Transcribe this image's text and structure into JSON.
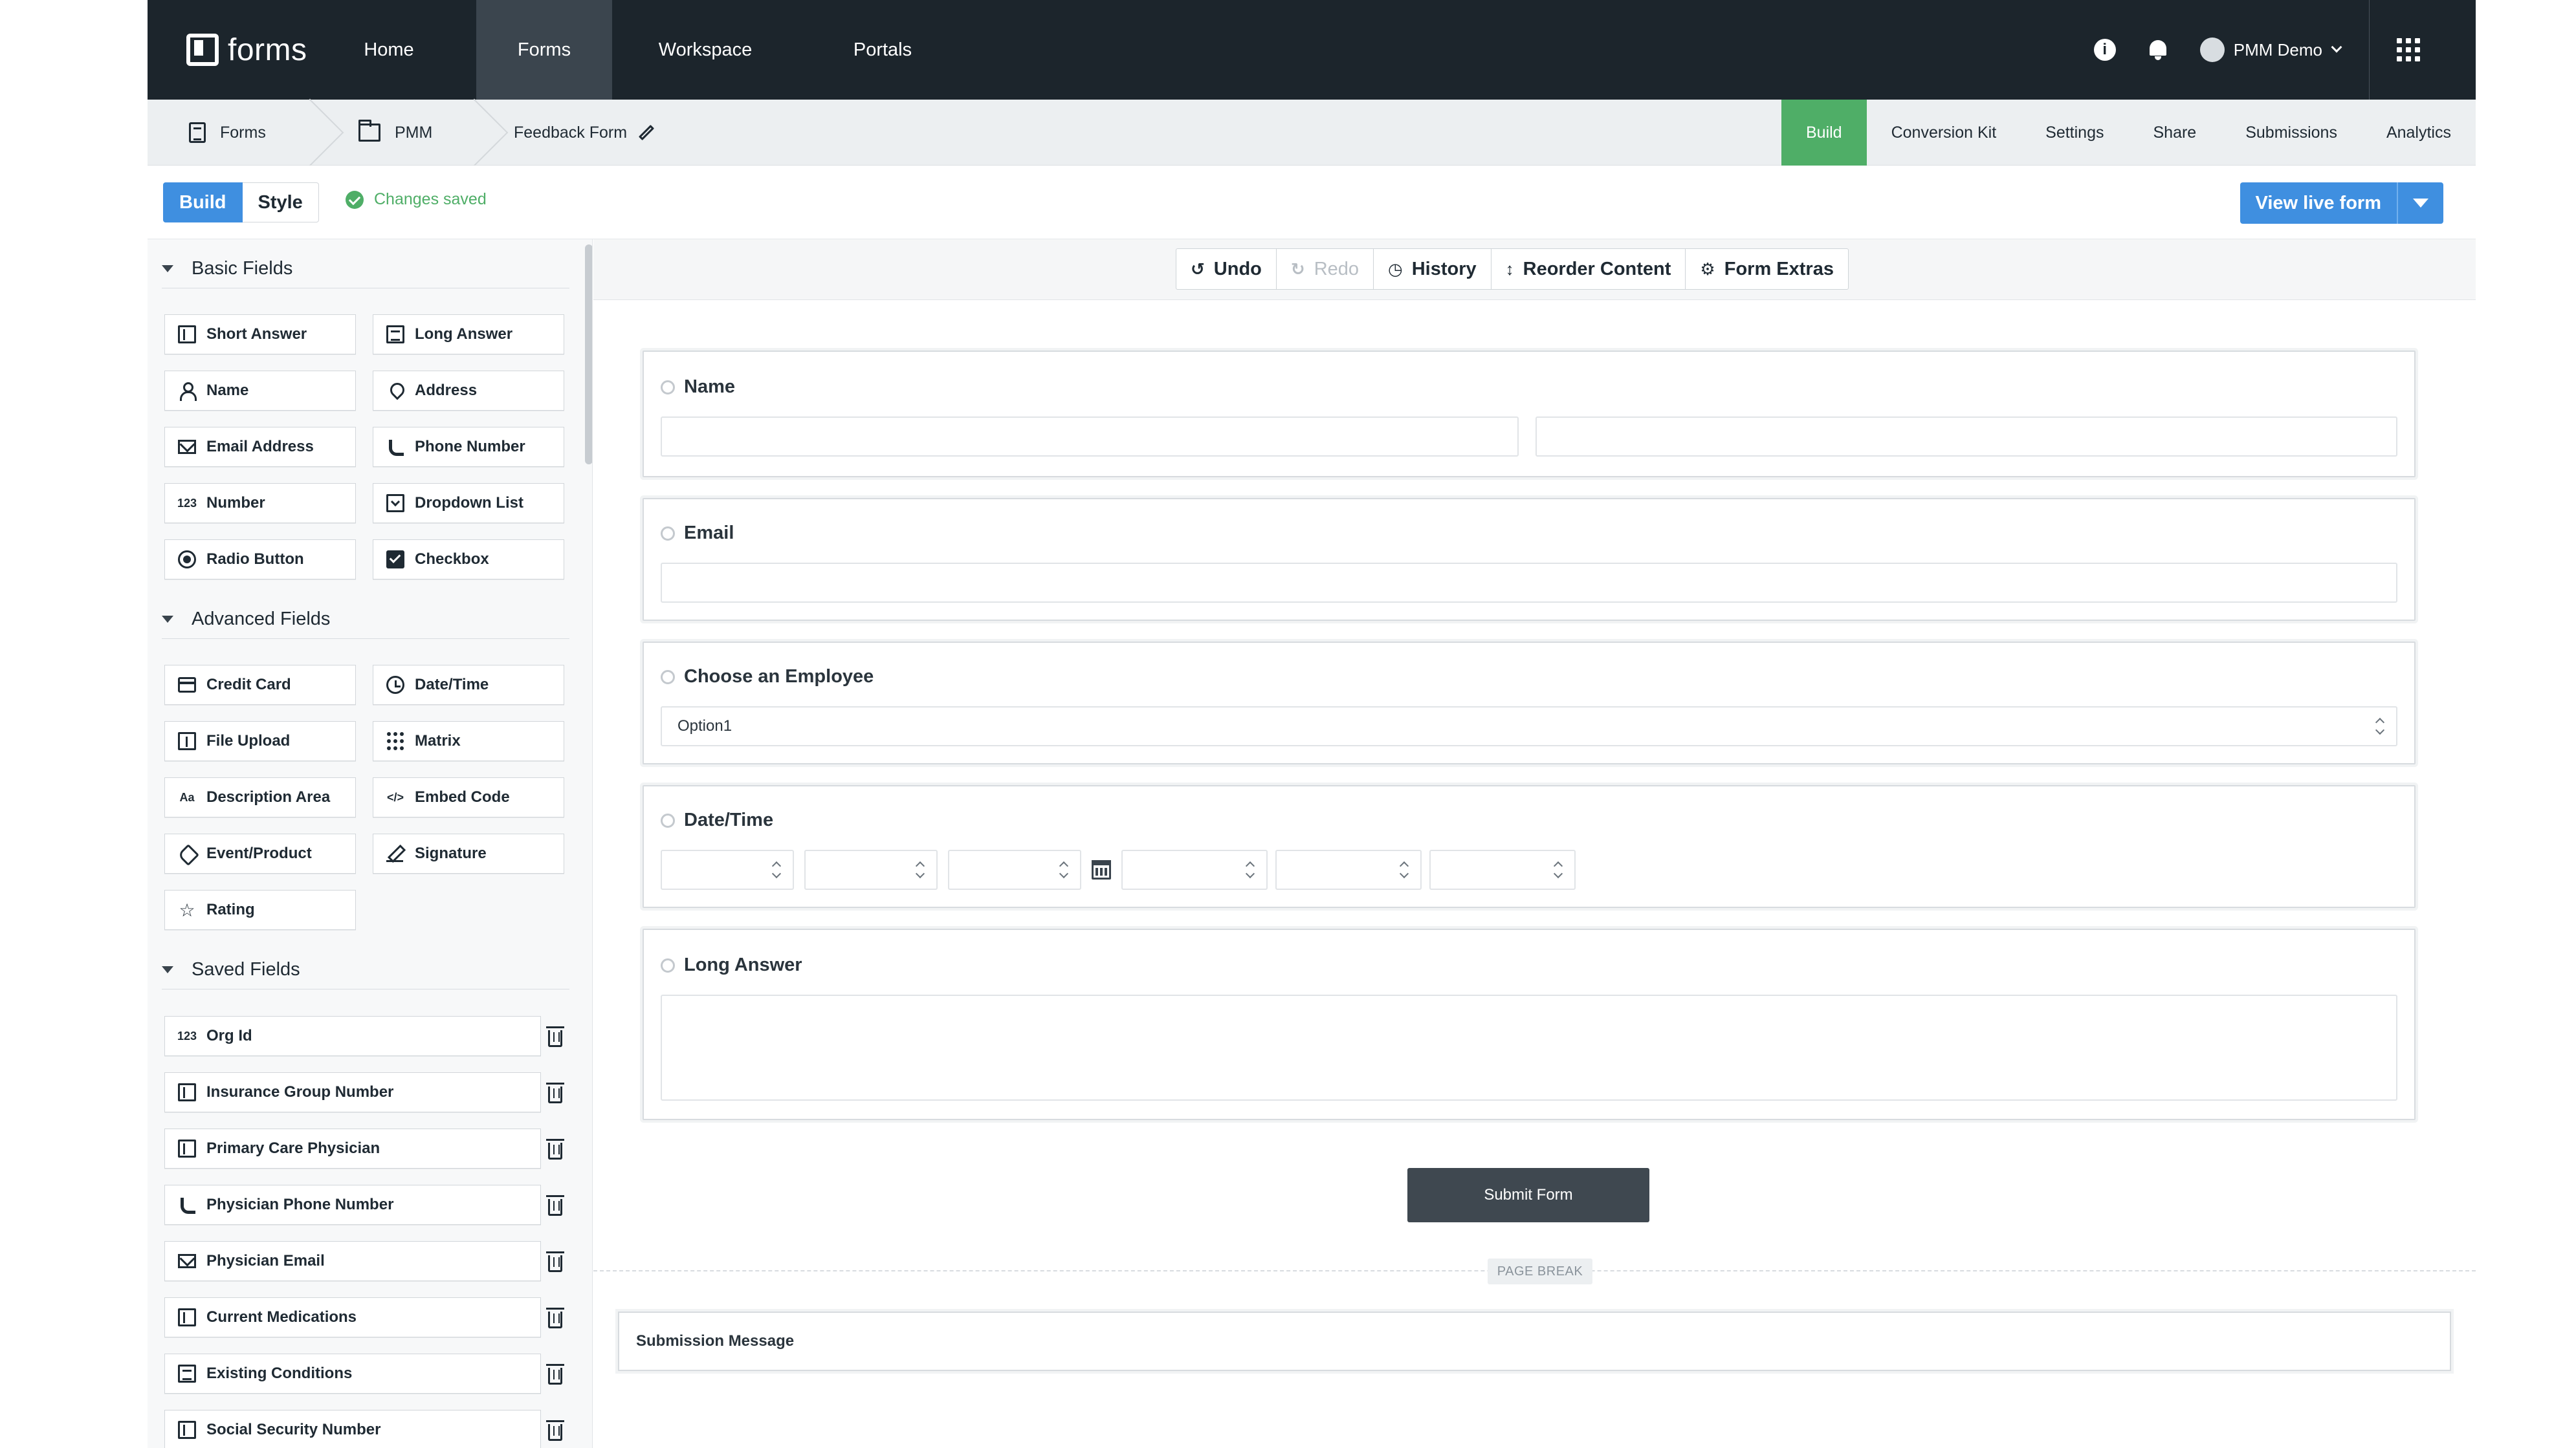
{
  "topnav": {
    "logo_text": "forms",
    "items": [
      {
        "label": "Home"
      },
      {
        "label": "Forms",
        "active": true
      },
      {
        "label": "Workspace"
      },
      {
        "label": "Portals"
      }
    ],
    "info_glyph": "i",
    "user_name": "PMM Demo"
  },
  "breadcrumb": {
    "items": [
      {
        "label": "Forms",
        "icon": "form-icon"
      },
      {
        "label": "PMM",
        "icon": "folder-icon"
      },
      {
        "label": "Feedback Form",
        "icon": "pencil-icon"
      }
    ]
  },
  "subtabs": [
    {
      "label": "Build",
      "active": true
    },
    {
      "label": "Conversion Kit"
    },
    {
      "label": "Settings"
    },
    {
      "label": "Share"
    },
    {
      "label": "Submissions"
    },
    {
      "label": "Analytics"
    }
  ],
  "mode": {
    "build_label": "Build",
    "style_label": "Style",
    "status": "Changes saved",
    "view_live_label": "View live form"
  },
  "sidebar": {
    "sections": [
      {
        "title": "Basic Fields",
        "fields": [
          {
            "label": "Short Answer",
            "icon": "short-answer-icon"
          },
          {
            "label": "Long Answer",
            "icon": "long-answer-icon"
          },
          {
            "label": "Name",
            "icon": "person-icon"
          },
          {
            "label": "Address",
            "icon": "map-pin-icon"
          },
          {
            "label": "Email Address",
            "icon": "envelope-icon"
          },
          {
            "label": "Phone Number",
            "icon": "phone-icon"
          },
          {
            "label": "Number",
            "icon": "number-icon",
            "glyph": "123"
          },
          {
            "label": "Dropdown List",
            "icon": "dropdown-icon"
          },
          {
            "label": "Radio Button",
            "icon": "radio-icon"
          },
          {
            "label": "Checkbox",
            "icon": "checkbox-icon"
          }
        ]
      },
      {
        "title": "Advanced Fields",
        "fields": [
          {
            "label": "Credit Card",
            "icon": "credit-card-icon"
          },
          {
            "label": "Date/Time",
            "icon": "clock-icon"
          },
          {
            "label": "File Upload",
            "icon": "upload-icon"
          },
          {
            "label": "Matrix",
            "icon": "matrix-icon"
          },
          {
            "label": "Description Area",
            "icon": "text-icon",
            "glyph": "Aa"
          },
          {
            "label": "Embed Code",
            "icon": "code-icon",
            "glyph": "</>"
          },
          {
            "label": "Event/Product",
            "icon": "tag-icon"
          },
          {
            "label": "Signature",
            "icon": "signature-icon"
          },
          {
            "label": "Rating",
            "icon": "star-icon",
            "glyph": "☆"
          }
        ]
      },
      {
        "title": "Saved Fields",
        "fields": [
          {
            "label": "Org Id",
            "icon": "number-icon",
            "glyph": "123"
          },
          {
            "label": "Insurance Group Number",
            "icon": "short-answer-icon"
          },
          {
            "label": "Primary Care Physician",
            "icon": "short-answer-icon"
          },
          {
            "label": "Physician Phone Number",
            "icon": "phone-icon"
          },
          {
            "label": "Physician Email",
            "icon": "envelope-icon"
          },
          {
            "label": "Current Medications",
            "icon": "short-answer-icon"
          },
          {
            "label": "Existing Conditions",
            "icon": "long-answer-icon"
          },
          {
            "label": "Social Security Number",
            "icon": "short-answer-icon"
          }
        ]
      }
    ]
  },
  "canvas": {
    "toolbar": [
      {
        "label": "Undo",
        "glyph": "↺",
        "enabled": true
      },
      {
        "label": "Redo",
        "glyph": "↻",
        "enabled": false
      },
      {
        "label": "History",
        "glyph": "◷",
        "enabled": true
      },
      {
        "label": "Reorder Content",
        "glyph": "↕",
        "enabled": true
      },
      {
        "label": "Form Extras",
        "glyph": "⚙",
        "enabled": true
      }
    ],
    "fields": [
      {
        "label": "Name"
      },
      {
        "label": "Email"
      },
      {
        "label": "Choose an Employee",
        "selected_option": "Option1"
      },
      {
        "label": "Date/Time"
      },
      {
        "label": "Long Answer"
      }
    ],
    "submit_label": "Submit Form",
    "page_break_label": "PAGE BREAK",
    "submission_message_label": "Submission Message"
  },
  "colors": {
    "nav_bg": "#1c252c",
    "accent_blue": "#3f8fe0",
    "accent_green": "#4fae67",
    "submit_bg": "#3f4850"
  }
}
